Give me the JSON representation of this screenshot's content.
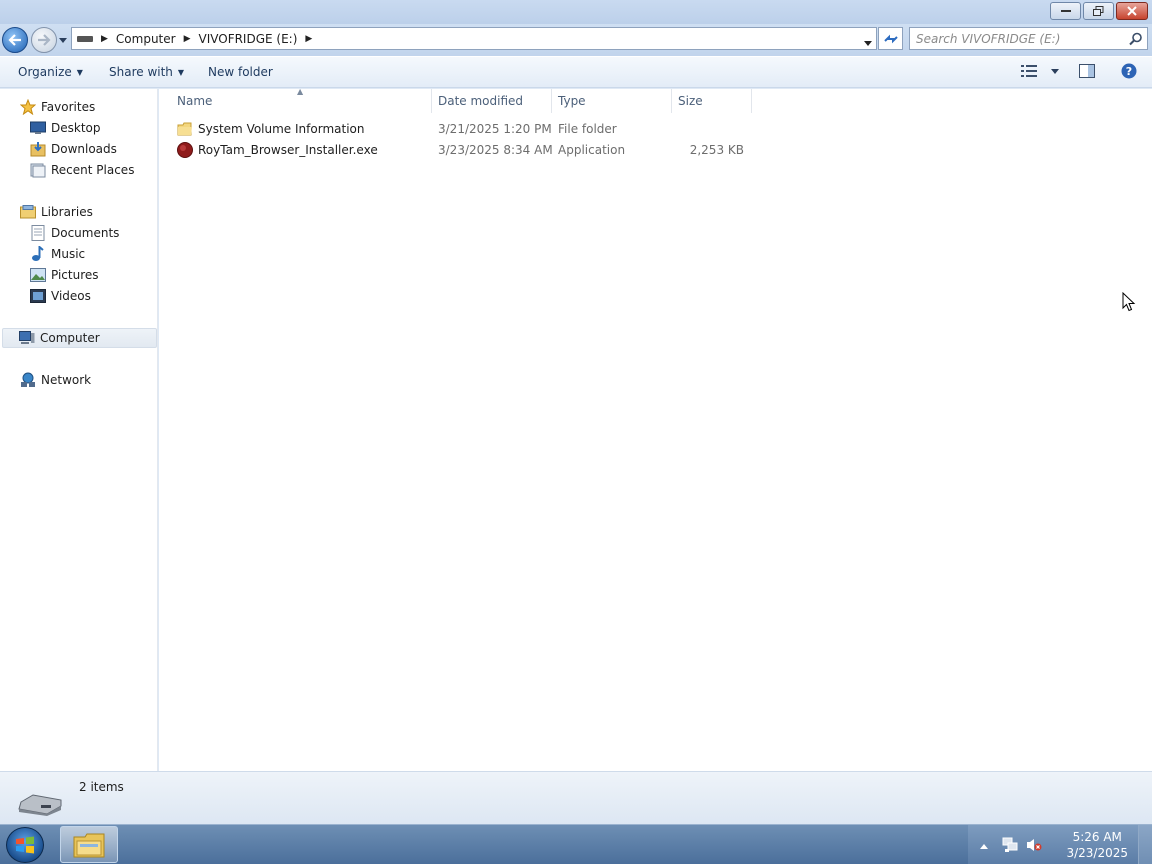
{
  "window": {
    "buttons": [
      "minimize",
      "restore",
      "close"
    ]
  },
  "address": {
    "breadcrumbs": [
      "Computer",
      "VIVOFRIDGE (E:)"
    ],
    "search_placeholder": "Search VIVOFRIDGE (E:)"
  },
  "toolbar": {
    "organize": "Organize",
    "share_with": "Share with",
    "new_folder": "New folder"
  },
  "nav": {
    "favorites": "Favorites",
    "desktop": "Desktop",
    "downloads": "Downloads",
    "recent_places": "Recent Places",
    "libraries": "Libraries",
    "documents": "Documents",
    "music": "Music",
    "pictures": "Pictures",
    "videos": "Videos",
    "computer": "Computer",
    "network": "Network",
    "selected": "Computer"
  },
  "columns": {
    "name": "Name",
    "date": "Date modified",
    "type": "Type",
    "size": "Size"
  },
  "files": [
    {
      "name": "System Volume Information",
      "date": "3/21/2025 1:20 PM",
      "type": "File folder",
      "size": "",
      "icon": "folder-icon"
    },
    {
      "name": "RoyTam_Browser_Installer.exe",
      "date": "3/23/2025 8:34 AM",
      "type": "Application",
      "size": "2,253 KB",
      "icon": "app-icon"
    }
  ],
  "status": {
    "count": "2 items"
  },
  "taskbar": {
    "time": "5:26 AM",
    "date": "3/23/2025"
  },
  "colors": {
    "accent": "#2d6cc0",
    "taskbar": "#4b6f9b"
  }
}
